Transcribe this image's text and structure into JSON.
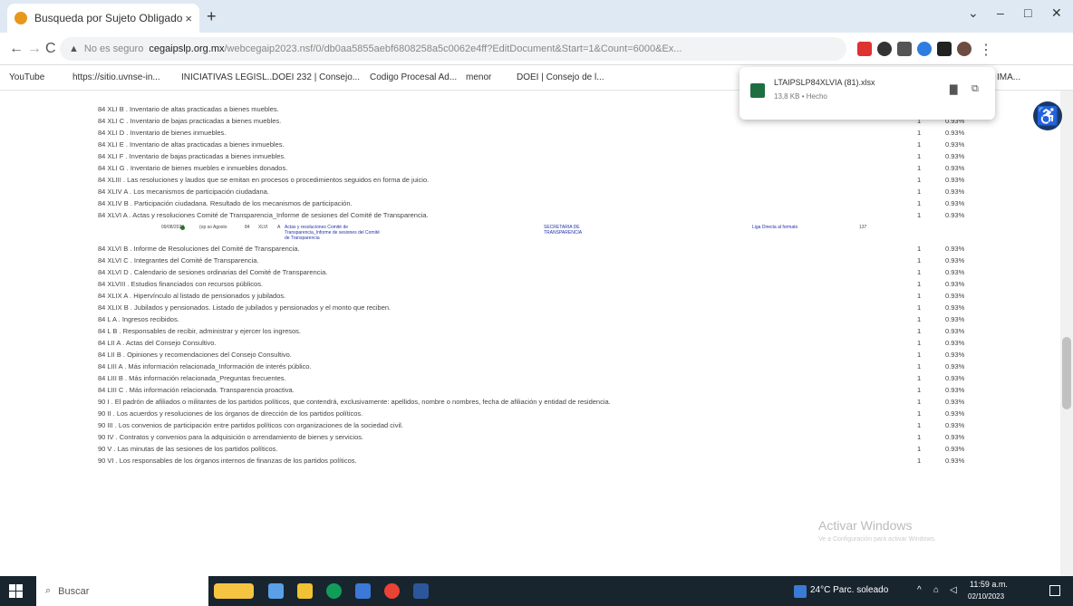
{
  "browser": {
    "tab_title": "Busqueda por Sujeto Obligado",
    "tab_close": "×",
    "new_tab": "+",
    "win_min": "–",
    "win_max": "□",
    "win_close": "✕",
    "back": "←",
    "forward": "→",
    "reload": "C",
    "security_label": "No es seguro",
    "url_host": "cegaipslp.org.mx",
    "url_path": "/webcegaip2023.nsf/0/db0aa5855aebf6808258a5c0062e4ff?EditDocument&Start=1&Count=6000&Ex...",
    "bookmarks": [
      "YouTube",
      "https://sitio.uvnse-in...",
      "INICIATIVAS LEGISL...",
      "DOEI 232 | Consejo...",
      "Codigo Procesal Ad...",
      "menor",
      "DOEI | Consejo de l...",
      "IMA..."
    ]
  },
  "download": {
    "file_name": "LTAIPSLP84XLVIA (81).xlsx",
    "status": "13,8 KB • Hecho"
  },
  "rows": [
    {
      "label": "84 XLI B . Inventario de altas practicadas a bienes muebles.",
      "count": "1",
      "pct": "0.93%"
    },
    {
      "label": "84 XLI C . Inventario de bajas practicadas a bienes muebles.",
      "count": "1",
      "pct": "0.93%"
    },
    {
      "label": "84 XLI D . Inventario de bienes inmuebles.",
      "count": "1",
      "pct": "0.93%"
    },
    {
      "label": "84 XLI E . Inventario de altas practicadas a bienes inmuebles.",
      "count": "1",
      "pct": "0.93%"
    },
    {
      "label": "84 XLI F . Inventario de bajas practicadas a bienes inmuebles.",
      "count": "1",
      "pct": "0.93%"
    },
    {
      "label": "84 XLI G . Inventario de bienes muebles e inmuebles donados.",
      "count": "1",
      "pct": "0.93%"
    },
    {
      "label": "84 XLIII . Las resoluciones y laudos que se emitan en procesos o procedimientos seguidos en forma de juicio.",
      "count": "1",
      "pct": "0.93%"
    },
    {
      "label": "84 XLIV A . Los mecanismos de participación ciudadana.",
      "count": "1",
      "pct": "0.93%"
    },
    {
      "label": "84 XLIV B . Participación ciudadana. Resultado de los mecanismos de participación.",
      "count": "1",
      "pct": "0.93%"
    },
    {
      "label": "84 XLVI A . Actas y resoluciones Comité de Transparencia_Informe de sesiones del Comité de Transparencia.",
      "count": "1",
      "pct": "0.93%"
    },
    {
      "label": "84 XLVI B . Informe de Resoluciones del Comité de Transparencia.",
      "count": "1",
      "pct": "0.93%"
    },
    {
      "label": "84 XLVI C . Integrantes del Comité de Transparencia.",
      "count": "1",
      "pct": "0.93%"
    },
    {
      "label": "84 XLVI D . Calendario de sesiones ordinarias del Comité de Transparencia.",
      "count": "1",
      "pct": "0.93%"
    },
    {
      "label": "84 XLVIII . Estudios financiados con recursos públicos.",
      "count": "1",
      "pct": "0.93%"
    },
    {
      "label": "84 XLIX A . Hipervínculo al listado de pensionados y jubilados.",
      "count": "1",
      "pct": "0.93%"
    },
    {
      "label": "84 XLIX B . Jubilados y pensionados. Listado de jubilados y pensionados y el monto que reciben.",
      "count": "1",
      "pct": "0.93%"
    },
    {
      "label": "84 L A . Ingresos recibidos.",
      "count": "1",
      "pct": "0.93%"
    },
    {
      "label": "84 L B . Responsables de recibir, administrar y ejercer los ingresos.",
      "count": "1",
      "pct": "0.93%"
    },
    {
      "label": "84 LII A . Actas del Consejo Consultivo.",
      "count": "1",
      "pct": "0.93%"
    },
    {
      "label": "84 LII B . Opiniones y recomendaciones del Consejo Consultivo.",
      "count": "1",
      "pct": "0.93%"
    },
    {
      "label": "84 LIII A . Más información relacionada_Información de interés público.",
      "count": "1",
      "pct": "0.93%"
    },
    {
      "label": "84 LIII B . Más información relacionada_Preguntas frecuentes.",
      "count": "1",
      "pct": "0.93%"
    },
    {
      "label": "84 LIII C . Más información relacionada. Transparencia proactiva.",
      "count": "1",
      "pct": "0.93%"
    },
    {
      "label": "90 I . El padrón de afiliados o militantes de los partidos políticos, que contendrá, exclusivamente: apellidos, nombre o nombres, fecha de afiliación y entidad de residencia.",
      "count": "1",
      "pct": "0.93%"
    },
    {
      "label": "90 II . Los acuerdos y resoluciones de los órganos de dirección de los partidos políticos.",
      "count": "1",
      "pct": "0.93%"
    },
    {
      "label": "90 III . Los convenios de participación entre partidos políticos con organizaciones de la sociedad civil.",
      "count": "1",
      "pct": "0.93%"
    },
    {
      "label": "90 IV . Contratos y convenios para la adquisición o arrendamiento de bienes y servicios.",
      "count": "1",
      "pct": "0.93%"
    },
    {
      "label": "90 V . Las minutas de las sesiones de los partidos políticos.",
      "count": "1",
      "pct": "0.93%"
    },
    {
      "label": "90 VI . Los responsables de los órganos internos de finanzas de los partidos políticos.",
      "count": "1",
      "pct": "0.93%"
    }
  ],
  "detail_row": {
    "date": "09/08/2023",
    "user": "(op so Agosto",
    "art": "84",
    "fraction": "XLVI",
    "inciso": "A",
    "title": "Actas y resoluciones Comité de Transparencia_Informe de sesiones del Comité de Transparencia",
    "area": "SECRETARIA DE TRANSPARENCIA",
    "link": "Liga Directa al formato",
    "num": "137"
  },
  "watermark": {
    "line1": "Activar Windows",
    "line2": "Ve a Configuración para activar Windows."
  },
  "taskbar": {
    "search_placeholder": "Buscar",
    "weather": "24°C  Parc. soleado",
    "time": "11:59 a.m.",
    "date": "02/10/2023"
  }
}
